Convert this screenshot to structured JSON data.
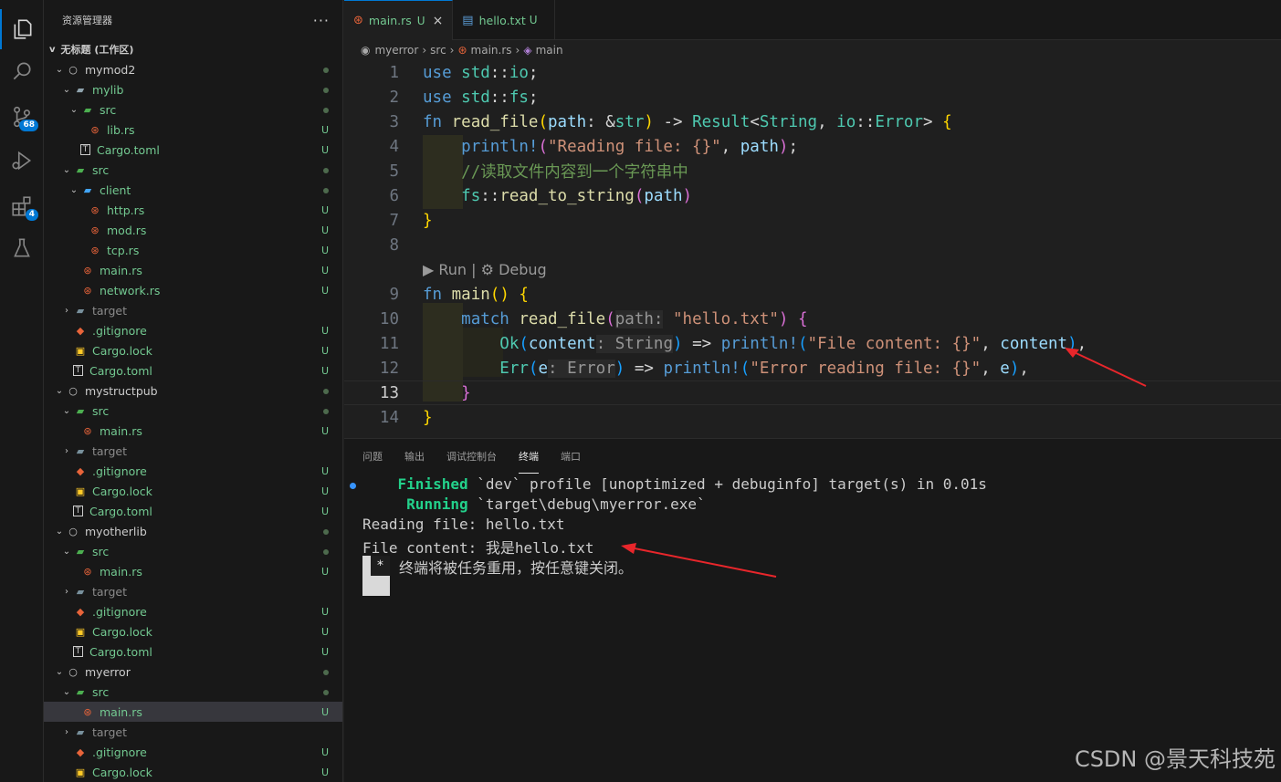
{
  "sidebar": {
    "header_title": "资源管理器",
    "more_label": "···",
    "workspace_title": "无标题 (工作区)",
    "items": [
      {
        "label": "mymod2",
        "depth": 1,
        "chev": "v",
        "icon": "project-circle-icon",
        "status": "dot",
        "style": "plain"
      },
      {
        "label": "mylib",
        "depth": 2,
        "chev": "v",
        "icon": "folder-icon",
        "status": "dot",
        "style": "green"
      },
      {
        "label": "src",
        "depth": 3,
        "chev": "v",
        "icon": "src-folder-icon",
        "status": "dot",
        "style": "green"
      },
      {
        "label": "lib.rs",
        "depth": 4,
        "chev": "",
        "icon": "rust-file-icon",
        "status": "U",
        "style": "green"
      },
      {
        "label": "Cargo.toml",
        "depth": 3,
        "chev": "",
        "icon": "toml-file-icon",
        "status": "U",
        "style": "green"
      },
      {
        "label": "src",
        "depth": 2,
        "chev": "v",
        "icon": "src-folder-icon",
        "status": "dot",
        "style": "green"
      },
      {
        "label": "client",
        "depth": 3,
        "chev": "v",
        "icon": "client-folder-icon",
        "status": "dot",
        "style": "green"
      },
      {
        "label": "http.rs",
        "depth": 4,
        "chev": "",
        "icon": "rust-file-icon",
        "status": "U",
        "style": "green"
      },
      {
        "label": "mod.rs",
        "depth": 4,
        "chev": "",
        "icon": "rust-file-icon",
        "status": "U",
        "style": "green"
      },
      {
        "label": "tcp.rs",
        "depth": 4,
        "chev": "",
        "icon": "rust-file-icon",
        "status": "U",
        "style": "green"
      },
      {
        "label": "main.rs",
        "depth": 3,
        "chev": "",
        "icon": "rust-file-icon",
        "status": "U",
        "style": "green"
      },
      {
        "label": "network.rs",
        "depth": 3,
        "chev": "",
        "icon": "rust-file-icon",
        "status": "U",
        "style": "green"
      },
      {
        "label": "target",
        "depth": 2,
        "chev": ">",
        "icon": "target-folder-icon",
        "status": "",
        "style": "gray"
      },
      {
        "label": ".gitignore",
        "depth": 2,
        "chev": "",
        "icon": "git-file-icon",
        "status": "U",
        "style": "green"
      },
      {
        "label": "Cargo.lock",
        "depth": 2,
        "chev": "",
        "icon": "lock-file-icon",
        "status": "U",
        "style": "green"
      },
      {
        "label": "Cargo.toml",
        "depth": 2,
        "chev": "",
        "icon": "toml-file-icon",
        "status": "U",
        "style": "green"
      },
      {
        "label": "mystructpub",
        "depth": 1,
        "chev": "v",
        "icon": "project-circle-icon",
        "status": "dot",
        "style": "plain"
      },
      {
        "label": "src",
        "depth": 2,
        "chev": "v",
        "icon": "src-folder-icon",
        "status": "dot",
        "style": "green"
      },
      {
        "label": "main.rs",
        "depth": 3,
        "chev": "",
        "icon": "rust-file-icon",
        "status": "U",
        "style": "green"
      },
      {
        "label": "target",
        "depth": 2,
        "chev": ">",
        "icon": "target-folder-icon",
        "status": "",
        "style": "gray"
      },
      {
        "label": ".gitignore",
        "depth": 2,
        "chev": "",
        "icon": "git-file-icon",
        "status": "U",
        "style": "green"
      },
      {
        "label": "Cargo.lock",
        "depth": 2,
        "chev": "",
        "icon": "lock-file-icon",
        "status": "U",
        "style": "green"
      },
      {
        "label": "Cargo.toml",
        "depth": 2,
        "chev": "",
        "icon": "toml-file-icon",
        "status": "U",
        "style": "green"
      },
      {
        "label": "myotherlib",
        "depth": 1,
        "chev": "v",
        "icon": "project-circle-icon",
        "status": "dot",
        "style": "plain"
      },
      {
        "label": "src",
        "depth": 2,
        "chev": "v",
        "icon": "src-folder-icon",
        "status": "dot",
        "style": "green"
      },
      {
        "label": "main.rs",
        "depth": 3,
        "chev": "",
        "icon": "rust-file-icon",
        "status": "U",
        "style": "green"
      },
      {
        "label": "target",
        "depth": 2,
        "chev": ">",
        "icon": "target-folder-icon",
        "status": "",
        "style": "gray"
      },
      {
        "label": ".gitignore",
        "depth": 2,
        "chev": "",
        "icon": "git-file-icon",
        "status": "U",
        "style": "green"
      },
      {
        "label": "Cargo.lock",
        "depth": 2,
        "chev": "",
        "icon": "lock-file-icon",
        "status": "U",
        "style": "green"
      },
      {
        "label": "Cargo.toml",
        "depth": 2,
        "chev": "",
        "icon": "toml-file-icon",
        "status": "U",
        "style": "green"
      },
      {
        "label": "myerror",
        "depth": 1,
        "chev": "v",
        "icon": "project-circle-icon",
        "status": "dot",
        "style": "plain"
      },
      {
        "label": "src",
        "depth": 2,
        "chev": "v",
        "icon": "src-folder-icon",
        "status": "dot",
        "style": "green"
      },
      {
        "label": "main.rs",
        "depth": 3,
        "chev": "",
        "icon": "rust-file-icon",
        "status": "U",
        "style": "green",
        "selected": true
      },
      {
        "label": "target",
        "depth": 2,
        "chev": ">",
        "icon": "target-folder-icon",
        "status": "",
        "style": "gray"
      },
      {
        "label": ".gitignore",
        "depth": 2,
        "chev": "",
        "icon": "git-file-icon",
        "status": "U",
        "style": "green"
      },
      {
        "label": "Cargo.lock",
        "depth": 2,
        "chev": "",
        "icon": "lock-file-icon",
        "status": "U",
        "style": "green"
      }
    ]
  },
  "activity": {
    "scm_badge": "68",
    "extensions_badge": "4"
  },
  "tabs": [
    {
      "label": "main.rs",
      "status": "U",
      "close": "×",
      "icon": "rust-file-icon",
      "active": true
    },
    {
      "label": "hello.txt",
      "status": "U",
      "icon": "text-file-icon",
      "active": false
    }
  ],
  "breadcrumb": [
    "myerror",
    "src",
    "main.rs",
    "main"
  ],
  "editor": {
    "codelens": "▶ Run | ⚙ Debug",
    "line_numbers": [
      "1",
      "2",
      "3",
      "4",
      "5",
      "6",
      "7",
      "8",
      "9",
      "10",
      "11",
      "12",
      "13",
      "14"
    ],
    "current_line": "13"
  },
  "panel": {
    "tabs": [
      "问题",
      "输出",
      "调试控制台",
      "终端",
      "端口"
    ],
    "active_tab": "终端",
    "terminal": {
      "finished_word": "Finished",
      "finished_rest": " `dev` profile [unoptimized + debuginfo] target(s) in 0.01s",
      "running_word": "Running",
      "running_rest": " `target\\debug\\myerror.exe`",
      "line3": "Reading file: hello.txt",
      "line4": "File content: 我是hello.txt",
      "cursor_char": "*",
      "line5": "终端将被任务重用，按任意键关闭。"
    }
  },
  "watermark": "CSDN @景天科技苑",
  "colors": {
    "accent": "#0078d4",
    "untracked": "#73c991",
    "arrow": "#e8262b"
  }
}
